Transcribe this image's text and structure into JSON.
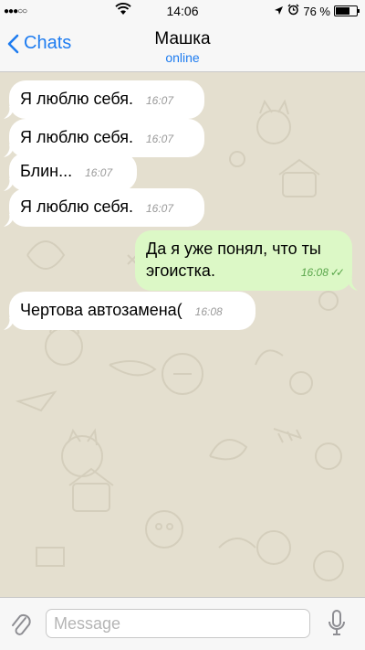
{
  "status_bar": {
    "signal": "●●●○○",
    "time": "14:06",
    "battery_text": "76 %",
    "battery_level": 0.76
  },
  "nav": {
    "back_label": "Chats",
    "contact_name": "Машка",
    "contact_status": "online"
  },
  "messages": [
    {
      "direction": "in",
      "text": "Я люблю себя.",
      "time": "16:07"
    },
    {
      "direction": "in",
      "text": "Я люблю себя.",
      "time": "16:07"
    },
    {
      "direction": "in",
      "text": "Блин...",
      "time": "16:07"
    },
    {
      "direction": "in",
      "text": "Я люблю себя.",
      "time": "16:07"
    },
    {
      "direction": "out",
      "text_line1": "Да я уже понял, что ты",
      "text_line2": "эгоистка.",
      "time": "16:08"
    },
    {
      "direction": "in",
      "text": "Чертова автозамена(",
      "time": "16:08"
    }
  ],
  "input": {
    "placeholder": "Message"
  },
  "icons": {
    "back": "chevron-left-icon",
    "attach": "paperclip-icon",
    "mic": "microphone-icon",
    "wifi": "wifi-icon",
    "location": "location-arrow-icon",
    "alarm": "alarm-clock-icon",
    "battery": "battery-icon"
  },
  "colors": {
    "accent": "#1e7cf0",
    "outgoing_bubble": "#dcf8c6",
    "incoming_bubble": "#ffffff",
    "read_check": "#5aa64b",
    "chat_background": "#e4dfcf"
  }
}
